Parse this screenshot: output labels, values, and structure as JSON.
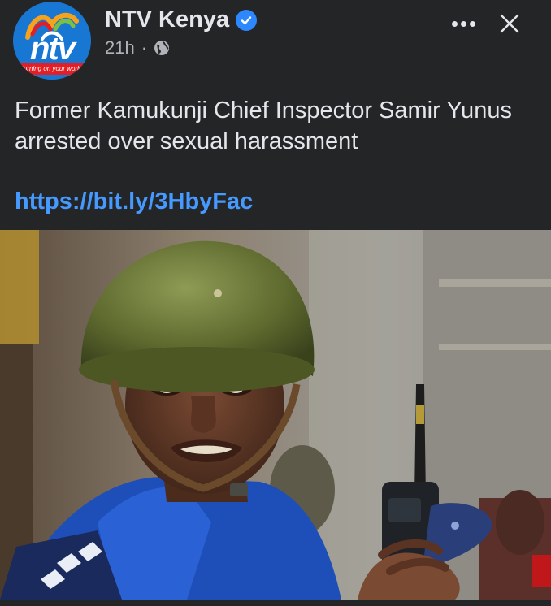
{
  "post": {
    "author": "NTV Kenya",
    "verified": true,
    "time": "21h",
    "separator": "·",
    "privacy_icon": "globe-icon",
    "text": "Former Kamukunji Chief Inspector Samir Yunus arrested over sexual harassment",
    "link": "https://bit.ly/3HbyFac"
  },
  "avatar": {
    "logo_text": "ntv",
    "tagline": "turning on your world"
  },
  "actions": {
    "more_icon": "more-icon",
    "close_icon": "close-icon"
  },
  "colors": {
    "background": "#242526",
    "link": "#4599ff",
    "verified": "#2d88ff",
    "text": "#e4e6eb",
    "muted": "#b0b3b8"
  }
}
